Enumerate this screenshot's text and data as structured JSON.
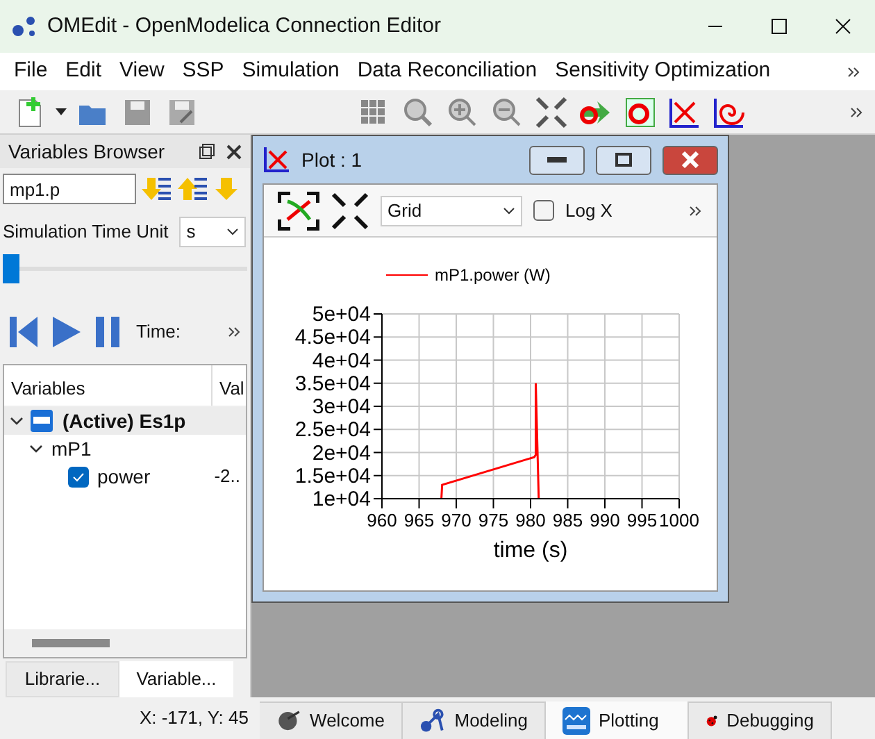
{
  "window": {
    "title": "OMEdit - OpenModelica Connection Editor"
  },
  "menu": [
    "File",
    "Edit",
    "View",
    "SSP",
    "Simulation",
    "Data Reconciliation",
    "Sensitivity Optimization"
  ],
  "variables_browser": {
    "title": "Variables Browser",
    "filter": "mp1.p",
    "time_unit_label": "Simulation Time Unit",
    "time_unit": "s",
    "slider": {
      "level": 0
    },
    "time_label": "Time:",
    "columns": [
      "Variables",
      "Val"
    ],
    "tree": [
      {
        "label": "(Active) Es1p",
        "expanded": true,
        "children": [
          {
            "label": "mP1",
            "expanded": true,
            "children": [
              {
                "label": "power",
                "checked": true,
                "value": "-2.."
              }
            ]
          }
        ]
      }
    ],
    "tabs": [
      {
        "label": "Librarie...",
        "selected": false
      },
      {
        "label": "Variable...",
        "selected": true
      }
    ]
  },
  "status_bar": "X: -171, Y: 45",
  "plot_window": {
    "title": "Plot : 1",
    "grid": "Grid",
    "log_x": {
      "label": "Log X",
      "checked": false
    },
    "chart_data": {
      "type": "line",
      "grid": true,
      "xlabel": "time (s)",
      "x": [
        968,
        968.1,
        980.5,
        980.7,
        980.7,
        981.1
      ],
      "series": [
        {
          "name": "mP1.power (W)",
          "color": "#ff0000",
          "values": [
            10000,
            13000,
            19000,
            19500,
            35000,
            10000
          ]
        }
      ],
      "xlim": [
        960,
        1000
      ],
      "ylim": [
        10000,
        50000
      ],
      "xticks": [
        960,
        965,
        970,
        975,
        980,
        985,
        990,
        995,
        1000
      ],
      "yticks": [
        {
          "value": 10000,
          "label": "1e+04"
        },
        {
          "value": 15000,
          "label": "1.5e+04"
        },
        {
          "value": 20000,
          "label": "2e+04"
        },
        {
          "value": 25000,
          "label": "2.5e+04"
        },
        {
          "value": 30000,
          "label": "3e+04"
        },
        {
          "value": 35000,
          "label": "3.5e+04"
        },
        {
          "value": 40000,
          "label": "4e+04"
        },
        {
          "value": 45000,
          "label": "4.5e+04"
        },
        {
          "value": 50000,
          "label": "5e+04"
        }
      ]
    }
  },
  "perspectives": [
    {
      "label": "Welcome",
      "kind": "welcome",
      "selected": false
    },
    {
      "label": "Modeling",
      "kind": "modeling",
      "selected": false
    },
    {
      "label": "Plotting",
      "kind": "plotting",
      "selected": true
    },
    {
      "label": "Debugging",
      "kind": "debugging",
      "selected": false
    }
  ]
}
